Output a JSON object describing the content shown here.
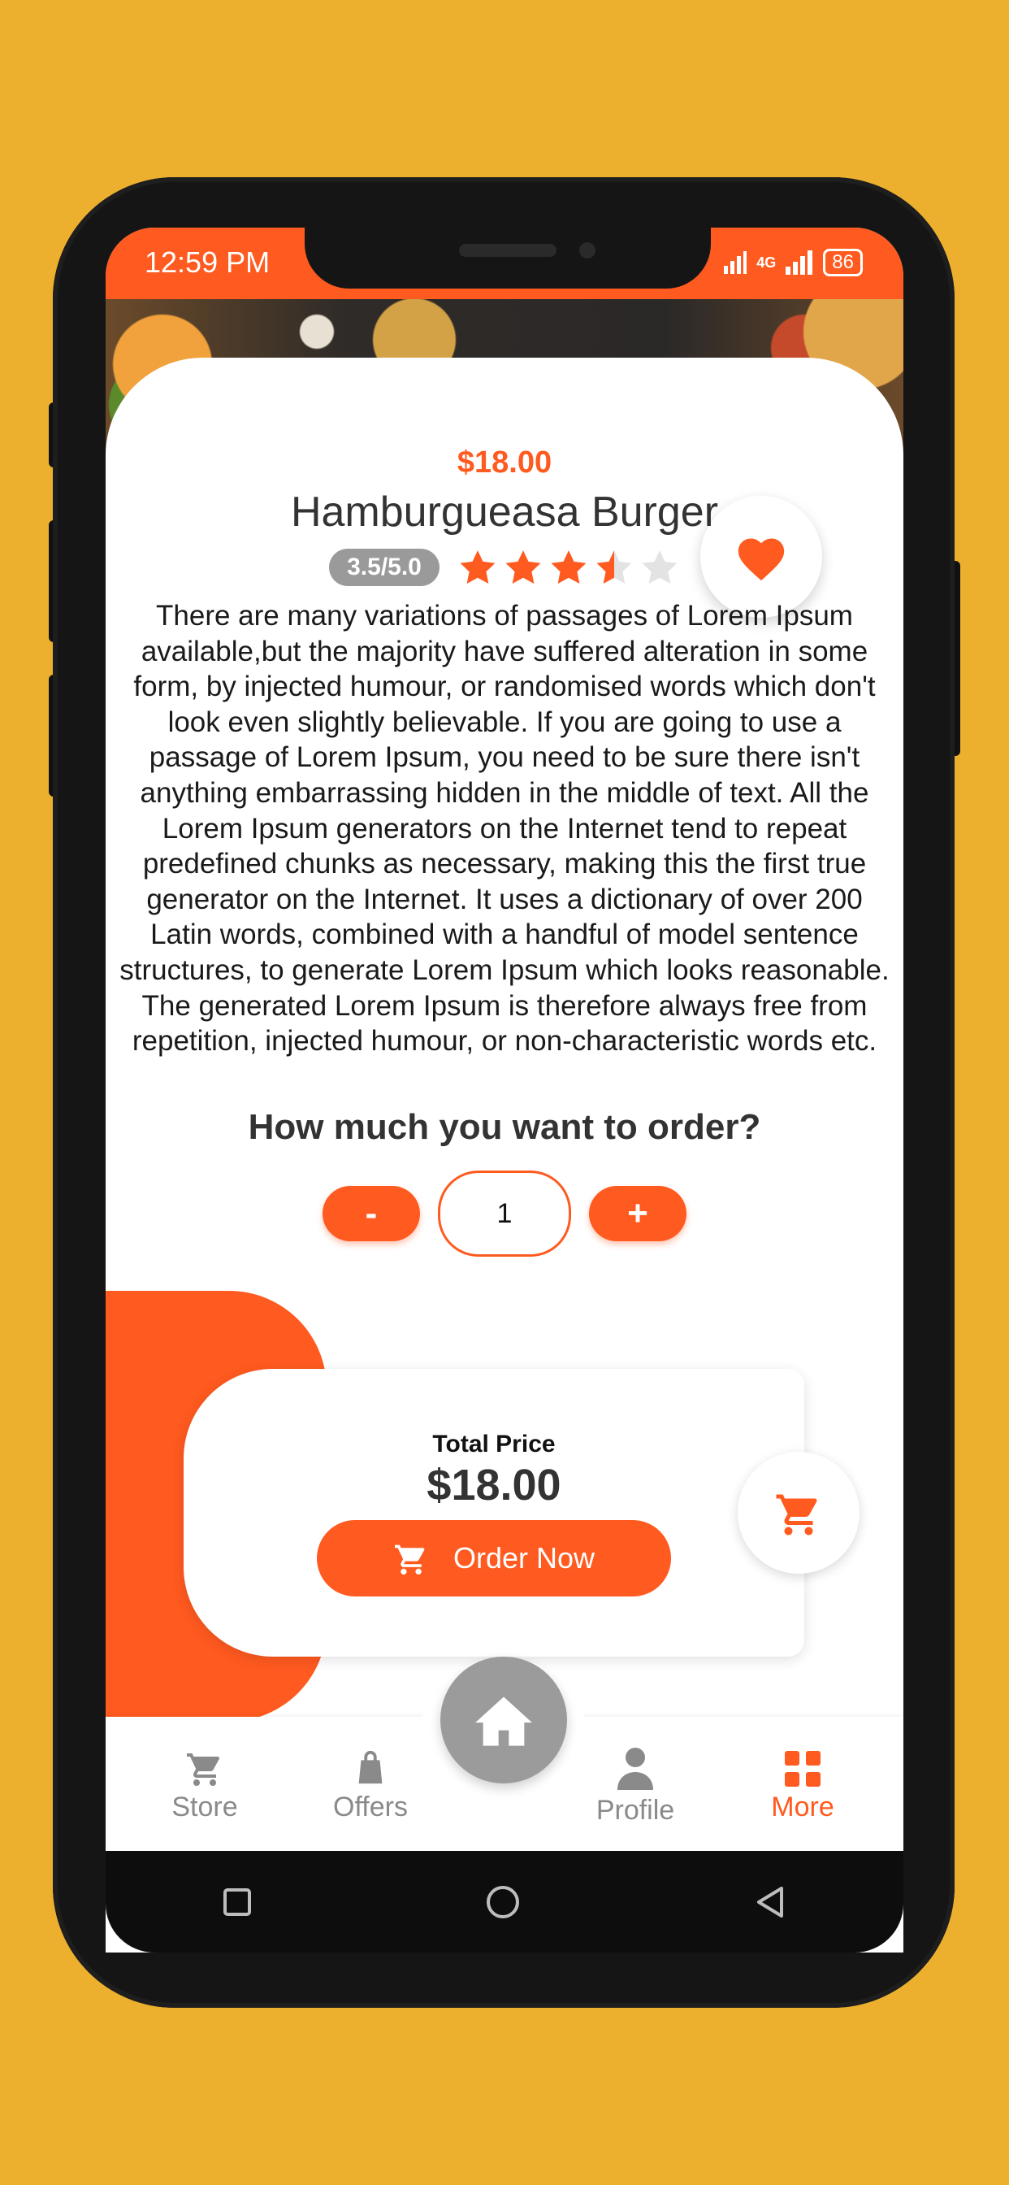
{
  "status_bar": {
    "time": "12:59 PM",
    "network": "4G",
    "battery": "86"
  },
  "product": {
    "price": "$18.00",
    "name": "Hamburgueasa Burger",
    "rating_text": "3.5/5.0",
    "rating_value": 3.5,
    "rating_max": 5,
    "description": "There are many variations of passages of Lorem Ipsum available,but the majority have suffered alteration in some form, by injected humour, or randomised words which don't look even slightly believable. If you are going to use a passage of Lorem Ipsum, you need to be sure there isn't anything embarrassing hidden in the middle of text. All the Lorem Ipsum generators on the Internet tend to repeat predefined chunks as necessary, making this the first true generator on the Internet. It uses a dictionary of over 200 Latin words, combined with a handful of model sentence structures, to generate Lorem Ipsum which looks reasonable. The generated Lorem Ipsum is therefore always free from repetition, injected humour, or non-characteristic words etc."
  },
  "order": {
    "question": "How much you want to order?",
    "decrement_label": "-",
    "quantity": "1",
    "increment_label": "+"
  },
  "total": {
    "label": "Total Price",
    "value": "$18.00",
    "order_button": "Order Now"
  },
  "bottom_nav": {
    "items": [
      {
        "label": "Store",
        "icon": "cart-icon",
        "active": false
      },
      {
        "label": "Offers",
        "icon": "shopping-bag-icon",
        "active": false
      },
      {
        "label": "Profile",
        "icon": "person-icon",
        "active": false
      },
      {
        "label": "More",
        "icon": "grid-icon",
        "active": true
      }
    ],
    "center_icon": "home-icon"
  },
  "colors": {
    "accent": "#FF5A1F",
    "background": "#EDB02E",
    "muted": "#9B9B9B"
  }
}
